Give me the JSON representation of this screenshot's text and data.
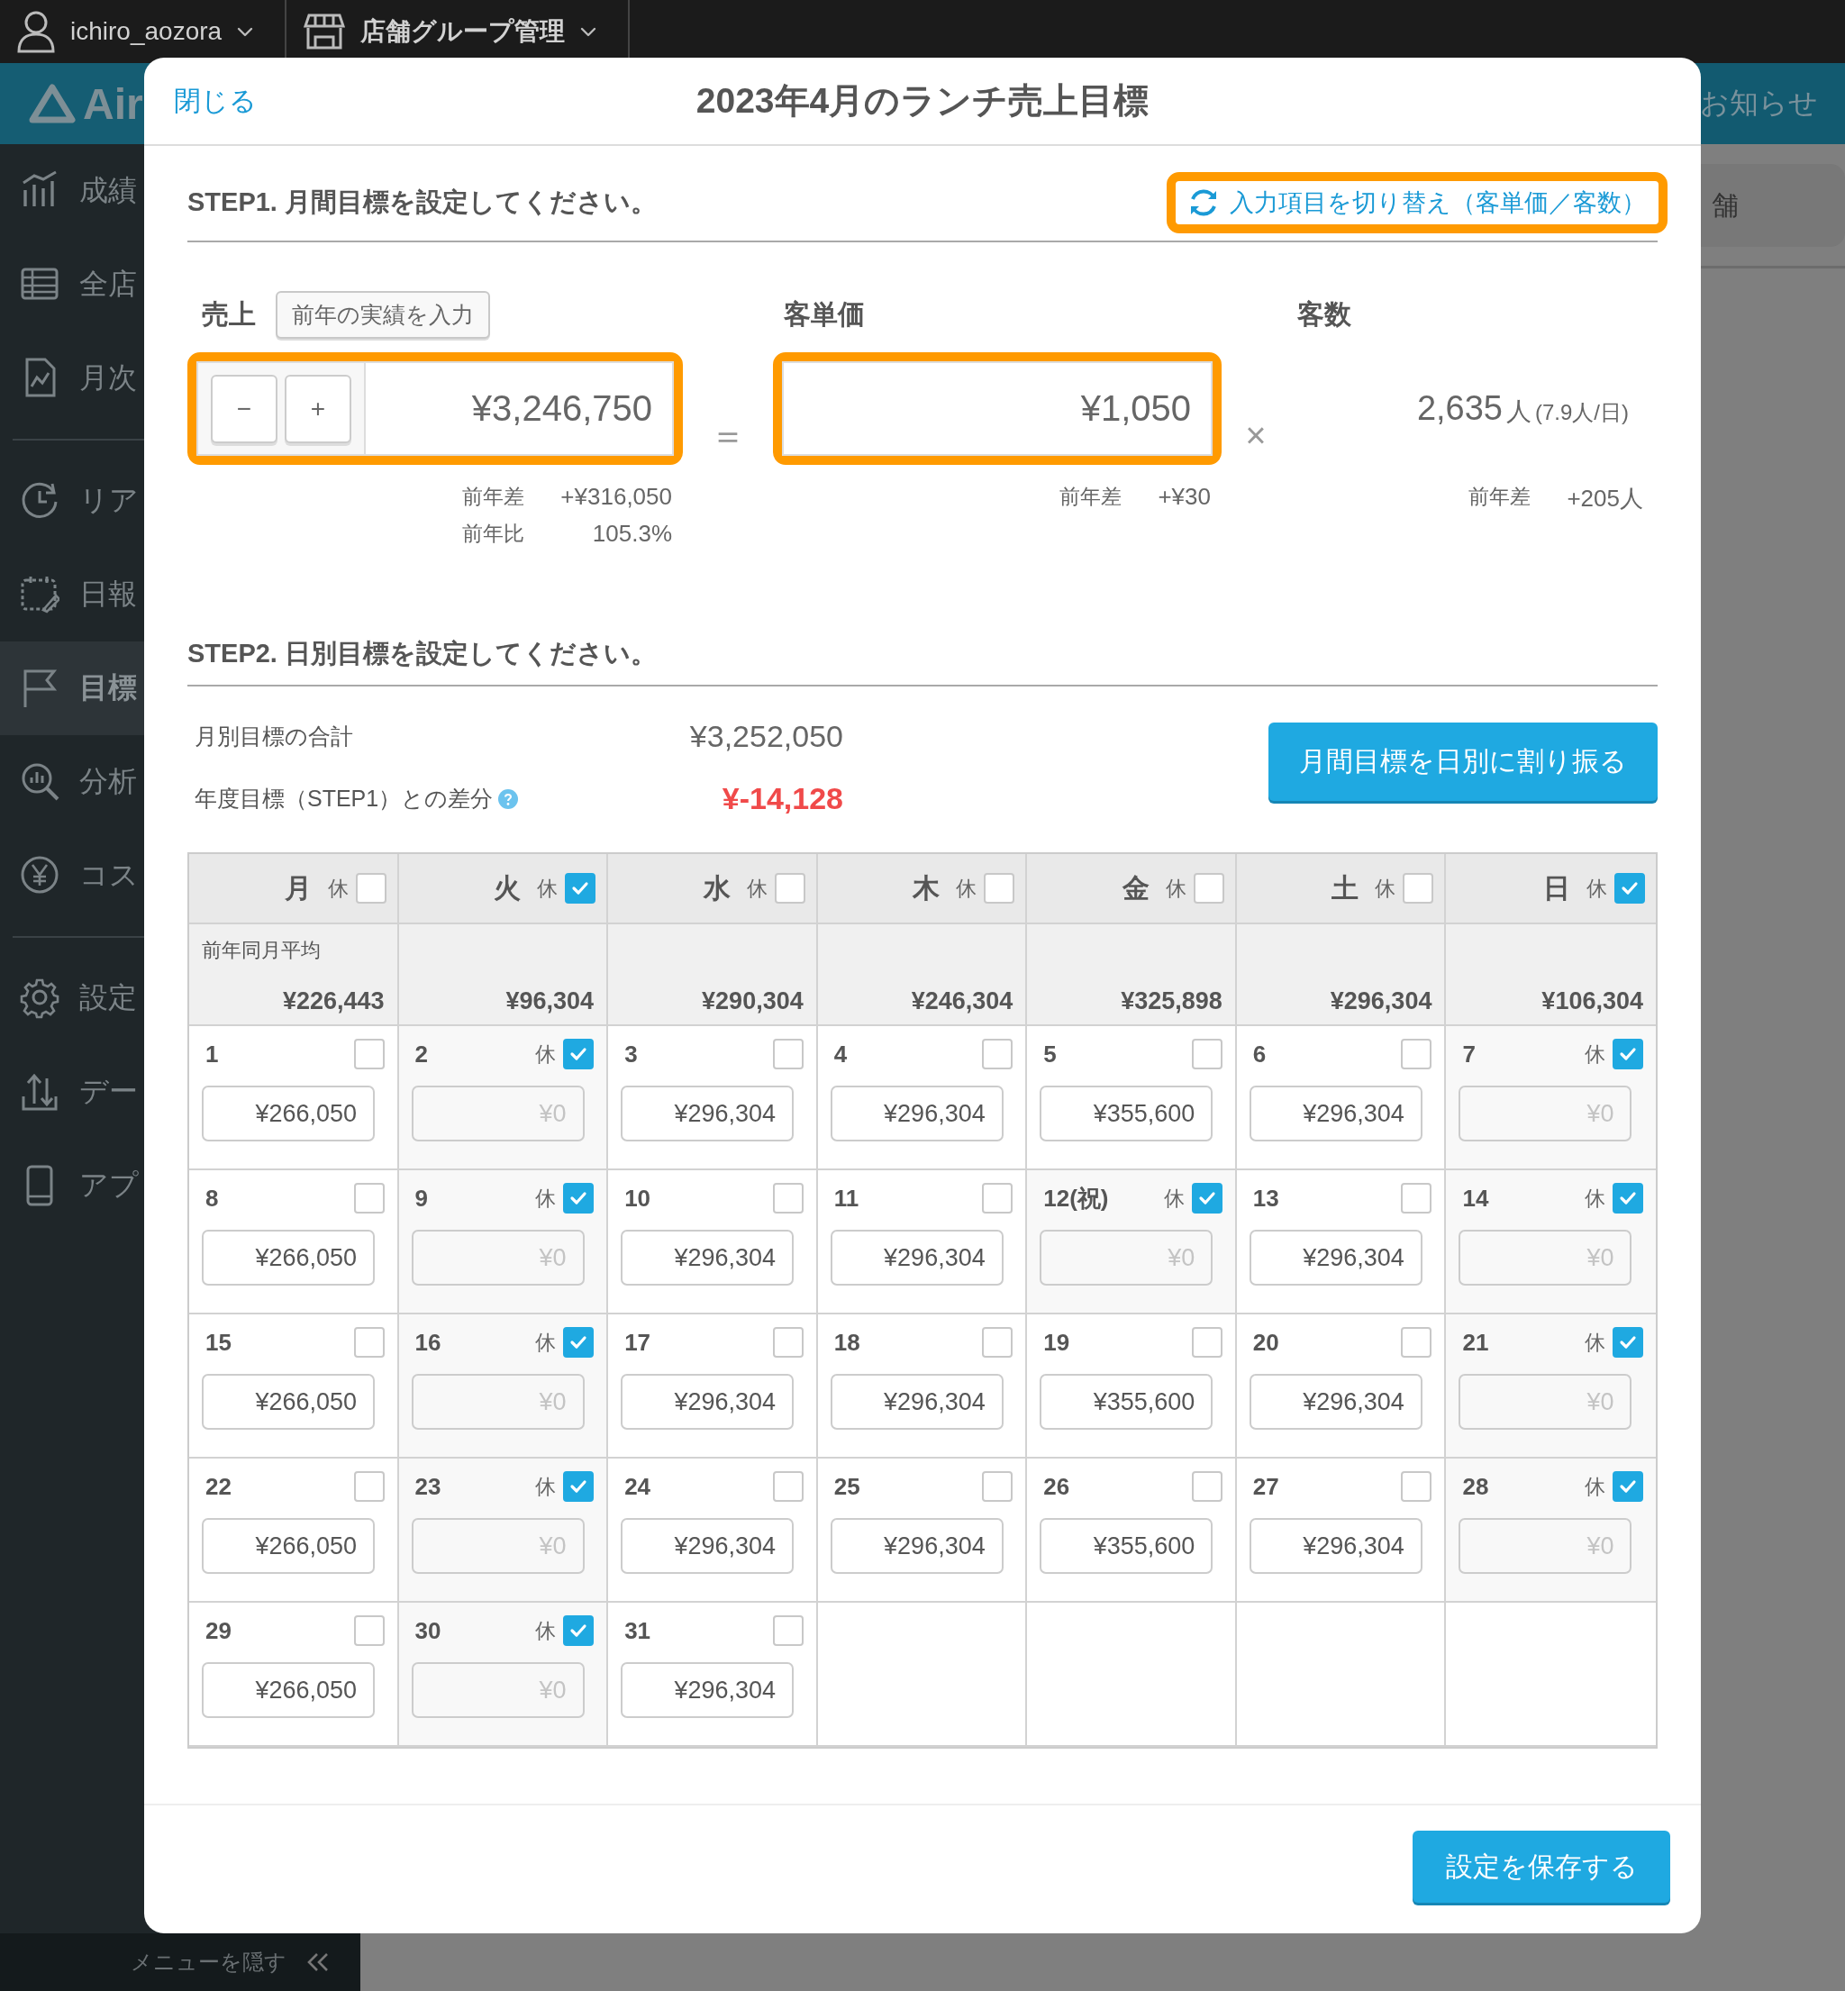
{
  "top_bar": {
    "user": "ichiro_aozora",
    "store_group": "店舗グループ管理"
  },
  "header": {
    "logo": "Air",
    "notice": "お知らせ",
    "store_button": "舗"
  },
  "sidebar": {
    "sections": [
      {
        "items": [
          {
            "label": "成績",
            "selected": false
          },
          {
            "label": "全店",
            "selected": false
          },
          {
            "label": "月次",
            "selected": false
          }
        ]
      },
      {
        "items": [
          {
            "label": "リア",
            "selected": false
          },
          {
            "label": "日報",
            "selected": false
          },
          {
            "label": "目標",
            "selected": true
          },
          {
            "label": "分析",
            "selected": false
          },
          {
            "label": "コス",
            "selected": false
          }
        ]
      },
      {
        "items": [
          {
            "label": "設定",
            "selected": false
          },
          {
            "label": "デー",
            "selected": false
          },
          {
            "label": "アプ",
            "selected": false
          }
        ]
      }
    ],
    "hide_menu": "メニューを隠す"
  },
  "modal": {
    "close": "閉じる",
    "title": "2023年4月のランチ売上目標",
    "step1": {
      "heading": "STEP1. 月間目標を設定してください。",
      "toggle": {
        "label": "入力項目を切り替え（客単価／客数）",
        "highlighted": true
      },
      "sales": {
        "label": "売上",
        "prev_button": "前年の実績を入力",
        "minus": "−",
        "plus": "+",
        "value": "¥3,246,750",
        "highlighted": true,
        "diff_label": "前年差",
        "diff": "+¥316,050",
        "ratio_label": "前年比",
        "ratio": "105.3%"
      },
      "equals": "＝",
      "unit_price": {
        "label": "客単価",
        "value": "¥1,050",
        "highlighted": true,
        "diff_label": "前年差",
        "diff": "+¥30"
      },
      "times": "×",
      "customers": {
        "label": "客数",
        "value": "2,635",
        "unit": "人",
        "per_day": "(7.9人/日)",
        "diff_label": "前年差",
        "diff": "+205人"
      }
    },
    "step2": {
      "heading": "STEP2. 日別目標を設定してください。",
      "total_label": "月別目標の合計",
      "total": "¥3,252,050",
      "gap_label": "年度目標（STEP1）との差分",
      "gap": "¥-14,128",
      "distribute_button": "月間目標を日別に割り振る",
      "calendar": {
        "weekdays": [
          {
            "label": "月",
            "rest_label": "休",
            "closed": false
          },
          {
            "label": "火",
            "rest_label": "休",
            "closed": true
          },
          {
            "label": "水",
            "rest_label": "休",
            "closed": false
          },
          {
            "label": "木",
            "rest_label": "休",
            "closed": false
          },
          {
            "label": "金",
            "rest_label": "休",
            "closed": false
          },
          {
            "label": "土",
            "rest_label": "休",
            "closed": false
          },
          {
            "label": "日",
            "rest_label": "休",
            "closed": true
          }
        ],
        "average_label": "前年同月平均",
        "averages": [
          "¥226,443",
          "¥96,304",
          "¥290,304",
          "¥246,304",
          "¥325,898",
          "¥296,304",
          "¥106,304"
        ],
        "weeks": [
          {
            "days": [
              {
                "day": "1",
                "closed": false,
                "value": "¥266,050"
              },
              {
                "day": "2",
                "rest_label": "休",
                "closed": true,
                "value": "¥0"
              },
              {
                "day": "3",
                "closed": false,
                "value": "¥296,304"
              },
              {
                "day": "4",
                "closed": false,
                "value": "¥296,304"
              },
              {
                "day": "5",
                "closed": false,
                "value": "¥355,600"
              },
              {
                "day": "6",
                "closed": false,
                "value": "¥296,304"
              },
              {
                "day": "7",
                "rest_label": "休",
                "closed": true,
                "value": "¥0"
              }
            ]
          },
          {
            "days": [
              {
                "day": "8",
                "closed": false,
                "value": "¥266,050"
              },
              {
                "day": "9",
                "rest_label": "休",
                "closed": true,
                "value": "¥0"
              },
              {
                "day": "10",
                "closed": false,
                "value": "¥296,304"
              },
              {
                "day": "11",
                "closed": false,
                "value": "¥296,304"
              },
              {
                "day": "12(祝)",
                "rest_label": "休",
                "closed": true,
                "value": "¥0"
              },
              {
                "day": "13",
                "closed": false,
                "value": "¥296,304"
              },
              {
                "day": "14",
                "rest_label": "休",
                "closed": true,
                "value": "¥0"
              }
            ]
          },
          {
            "days": [
              {
                "day": "15",
                "closed": false,
                "value": "¥266,050"
              },
              {
                "day": "16",
                "rest_label": "休",
                "closed": true,
                "value": "¥0"
              },
              {
                "day": "17",
                "closed": false,
                "value": "¥296,304"
              },
              {
                "day": "18",
                "closed": false,
                "value": "¥296,304"
              },
              {
                "day": "19",
                "closed": false,
                "value": "¥355,600"
              },
              {
                "day": "20",
                "closed": false,
                "value": "¥296,304"
              },
              {
                "day": "21",
                "rest_label": "休",
                "closed": true,
                "value": "¥0"
              }
            ]
          },
          {
            "days": [
              {
                "day": "22",
                "closed": false,
                "value": "¥266,050"
              },
              {
                "day": "23",
                "rest_label": "休",
                "closed": true,
                "value": "¥0"
              },
              {
                "day": "24",
                "closed": false,
                "value": "¥296,304"
              },
              {
                "day": "25",
                "closed": false,
                "value": "¥296,304"
              },
              {
                "day": "26",
                "closed": false,
                "value": "¥355,600"
              },
              {
                "day": "27",
                "closed": false,
                "value": "¥296,304"
              },
              {
                "day": "28",
                "rest_label": "休",
                "closed": true,
                "value": "¥0"
              }
            ]
          },
          {
            "days": [
              {
                "day": "29",
                "closed": false,
                "value": "¥266,050"
              },
              {
                "day": "30",
                "rest_label": "休",
                "closed": true,
                "value": "¥0"
              },
              {
                "day": "31",
                "closed": false,
                "value": "¥296,304"
              }
            ]
          }
        ]
      }
    },
    "save_button": "設定を保存する"
  }
}
